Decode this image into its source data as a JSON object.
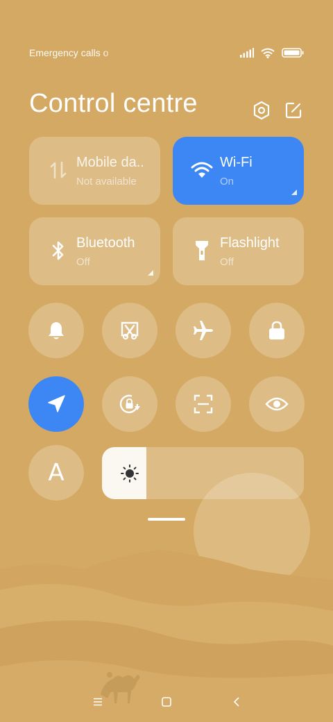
{
  "status_bar": {
    "carrier_text": "Emergency calls o"
  },
  "header": {
    "title": "Control centre"
  },
  "tiles": [
    {
      "label": "Mobile da..",
      "sub": "Not available",
      "icon": "mobile-data-icon",
      "active": false
    },
    {
      "label": "Wi-Fi",
      "sub": "On",
      "icon": "wifi-icon",
      "active": true
    },
    {
      "label": "Bluetooth",
      "sub": "Off",
      "icon": "bluetooth-icon",
      "active": false
    },
    {
      "label": "Flashlight",
      "sub": "Off",
      "icon": "flashlight-icon",
      "active": false
    }
  ],
  "toggles": [
    {
      "icon": "bell-icon",
      "active": false
    },
    {
      "icon": "screenshot-icon",
      "active": false
    },
    {
      "icon": "airplane-icon",
      "active": false
    },
    {
      "icon": "lock-icon",
      "active": false
    },
    {
      "icon": "location-icon",
      "active": true
    },
    {
      "icon": "rotation-lock-icon",
      "active": false
    },
    {
      "icon": "scanner-icon",
      "active": false
    },
    {
      "icon": "eye-icon",
      "active": false
    }
  ],
  "auto_brightness_letter": "A",
  "brightness": {
    "level": 0.22
  },
  "colors": {
    "background": "#d4a964",
    "accent": "#3d87f5",
    "tile": "rgba(255,255,255,0.22)"
  }
}
